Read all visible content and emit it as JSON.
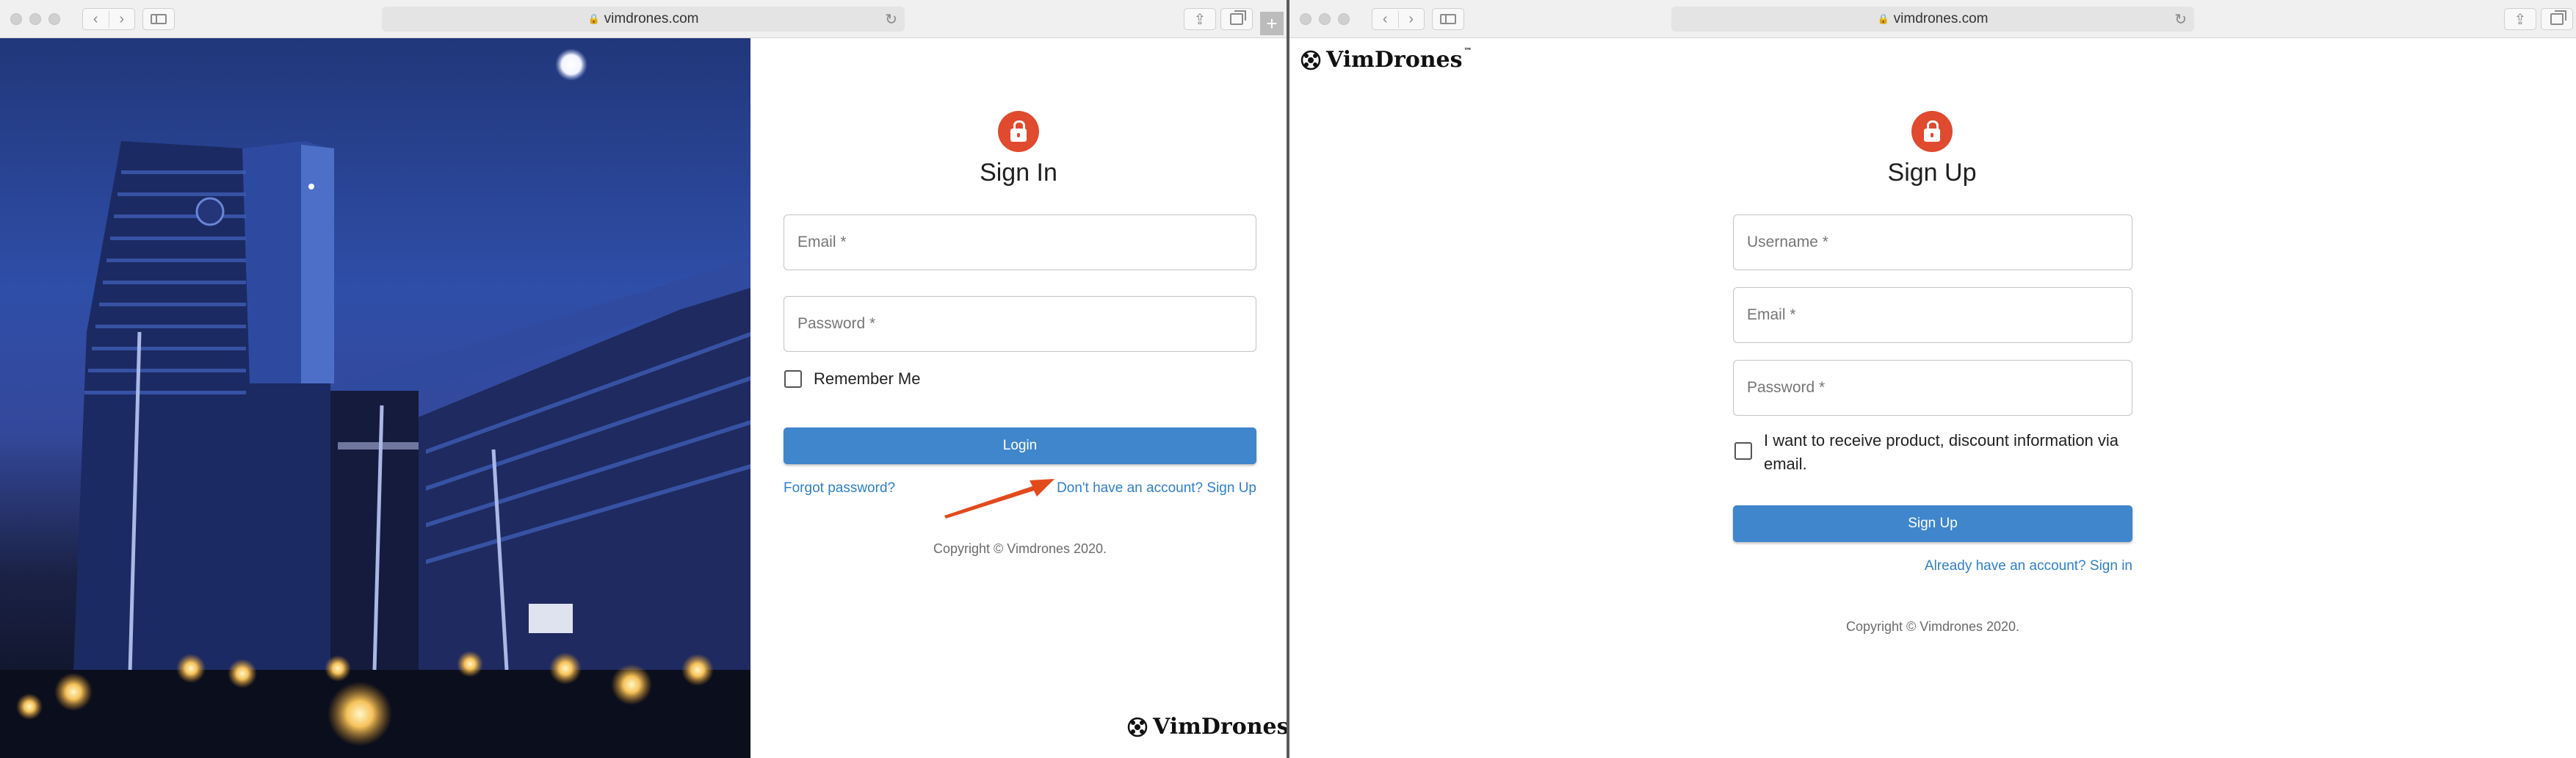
{
  "browser": {
    "left_url": "vimdrones.com",
    "right_url": "vimdrones.com"
  },
  "brand": {
    "name": "VimDrones",
    "tm": "™"
  },
  "signin": {
    "title": "Sign In",
    "email_placeholder": "Email *",
    "password_placeholder": "Password *",
    "remember_label": "Remember Me",
    "login_label": "Login",
    "forgot_link": "Forgot password?",
    "signup_link": "Don't have an account? Sign Up",
    "copyright": "Copyright © Vimdrones 2020."
  },
  "signup": {
    "title": "Sign Up",
    "username_placeholder": "Username *",
    "email_placeholder": "Email *",
    "password_placeholder": "Password *",
    "optin_label": "I want to receive product, discount information via email.",
    "signup_label": "Sign Up",
    "signin_link": "Already have an account? Sign in",
    "copyright": "Copyright © Vimdrones 2020."
  },
  "colors": {
    "accent": "#3f86cc",
    "avatar": "#e04a2f",
    "link": "#2f7fc7",
    "annotation_arrow": "#e24a1c"
  },
  "icons": {
    "avatar_icon": "lock-icon",
    "logo_icon": "drone-logo-icon",
    "annotation": "arrow-icon"
  }
}
